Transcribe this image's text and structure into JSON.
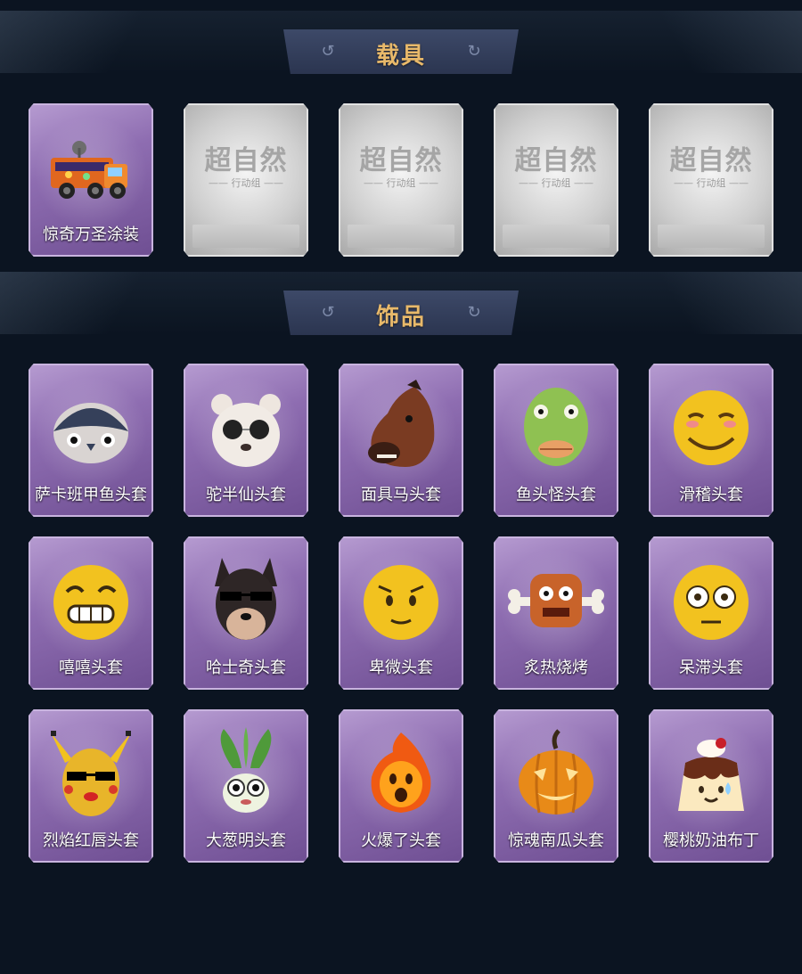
{
  "sections": {
    "vehicles": {
      "title": "载具"
    },
    "accessories": {
      "title": "饰品"
    }
  },
  "vehicle_cards": [
    {
      "label": "惊奇万圣涂装",
      "icon": "halloween-truck-icon",
      "locked": false
    },
    {
      "placeholder_main": "超自然",
      "placeholder_sub": "—— 行动组 ——",
      "locked": true
    },
    {
      "placeholder_main": "超自然",
      "placeholder_sub": "—— 行动组 ——",
      "locked": true
    },
    {
      "placeholder_main": "超自然",
      "placeholder_sub": "—— 行动组 ——",
      "locked": true
    },
    {
      "placeholder_main": "超自然",
      "placeholder_sub": "—— 行动组 ——",
      "locked": true
    }
  ],
  "accessory_cards": [
    {
      "label": "萨卡班甲鱼头套",
      "icon": "fish-head-icon"
    },
    {
      "label": "驼半仙头套",
      "icon": "bear-sunglasses-icon"
    },
    {
      "label": "面具马头套",
      "icon": "horse-mask-icon"
    },
    {
      "label": "鱼头怪头套",
      "icon": "green-fish-icon"
    },
    {
      "label": "滑稽头套",
      "icon": "smirk-emoji-icon"
    },
    {
      "label": "嘻嘻头套",
      "icon": "grin-emoji-icon"
    },
    {
      "label": "哈士奇头套",
      "icon": "husky-icon"
    },
    {
      "label": "卑微头套",
      "icon": "shy-emoji-icon"
    },
    {
      "label": "炙热烧烤",
      "icon": "meat-bone-icon"
    },
    {
      "label": "呆滞头套",
      "icon": "dazed-emoji-icon"
    },
    {
      "label": "烈焰红唇头套",
      "icon": "yellow-creature-icon"
    },
    {
      "label": "大葱明头套",
      "icon": "scallion-icon"
    },
    {
      "label": "火爆了头套",
      "icon": "fire-spirit-icon"
    },
    {
      "label": "惊魂南瓜头套",
      "icon": "pumpkin-icon"
    },
    {
      "label": "樱桃奶油布丁",
      "icon": "pudding-icon"
    }
  ],
  "colors": {
    "background": "#0b1421",
    "title_gold": "#e8b96a",
    "card_purple": "#8e6db1",
    "card_gray": "#c4c4c4"
  }
}
